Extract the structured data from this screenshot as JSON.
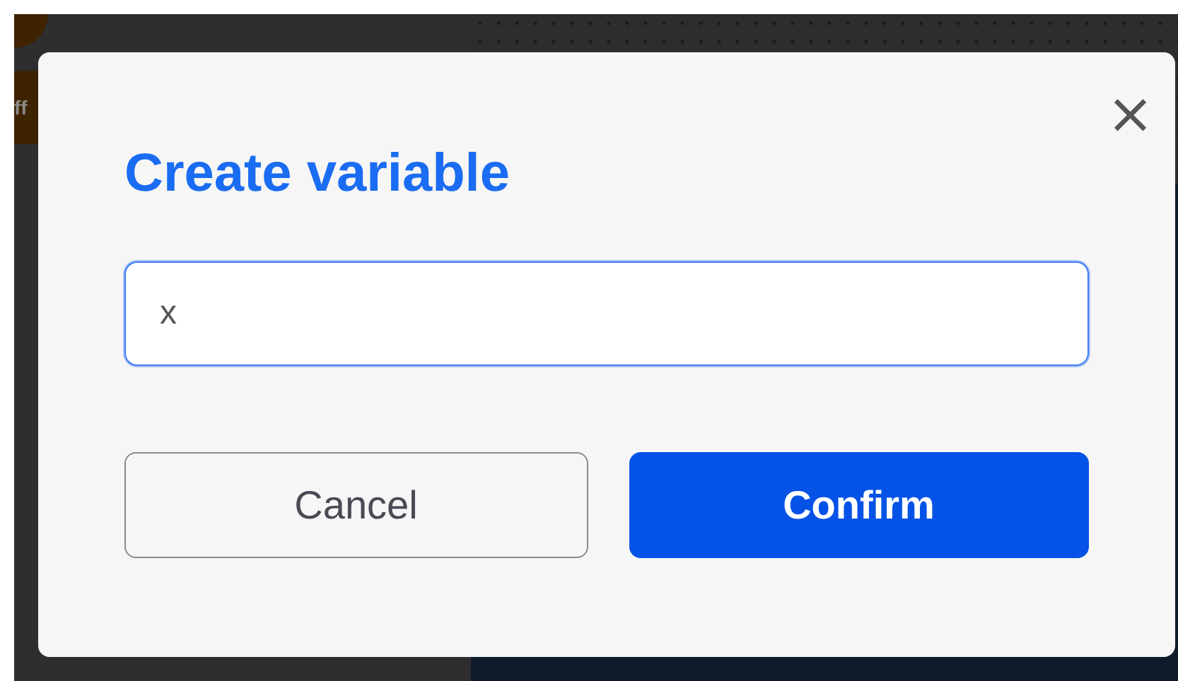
{
  "background": {
    "label": "ff"
  },
  "dialog": {
    "title": "Create variable",
    "close": "×",
    "field": {
      "value": "x",
      "focused": true
    },
    "buttons": [
      {
        "label": "Cancel",
        "kind": "secondary"
      },
      {
        "label": "Confirm",
        "kind": "primary"
      }
    ]
  }
}
